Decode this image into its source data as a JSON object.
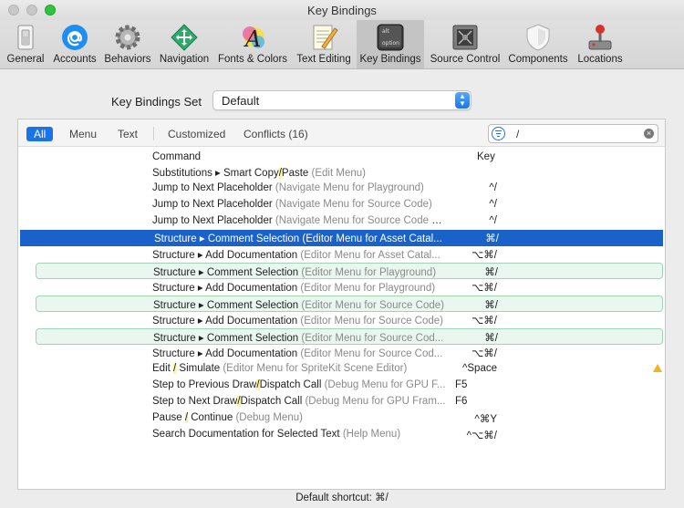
{
  "window": {
    "title": "Key Bindings"
  },
  "toolbar": {
    "items": [
      {
        "label": "General",
        "icon": "switch-icon"
      },
      {
        "label": "Accounts",
        "icon": "at-sign-icon"
      },
      {
        "label": "Behaviors",
        "icon": "gear-icon"
      },
      {
        "label": "Navigation",
        "icon": "move-arrows-icon"
      },
      {
        "label": "Fonts & Colors",
        "icon": "font-a-icon"
      },
      {
        "label": "Text Editing",
        "icon": "notepad-pencil-icon"
      },
      {
        "label": "Key Bindings",
        "icon": "option-key-icon"
      },
      {
        "label": "Source Control",
        "icon": "vault-icon"
      },
      {
        "label": "Components",
        "icon": "shield-icon"
      },
      {
        "label": "Locations",
        "icon": "joystick-icon"
      }
    ]
  },
  "key_bindings_set": {
    "label": "Key Bindings Set",
    "value": "Default"
  },
  "filters": {
    "all": "All",
    "menu": "Menu",
    "text": "Text",
    "customized": "Customized",
    "conflicts": "Conflicts (16)"
  },
  "search": {
    "value": "/"
  },
  "columns": {
    "command": "Command",
    "key": "Key"
  },
  "rows": [
    {
      "pre": "Substitutions ▸ Smart Copy",
      "hl": "/",
      "post": "Paste",
      "ctx": " (Edit Menu)",
      "key": "",
      "state": "normal"
    },
    {
      "pre": "Jump to Next Placeholder",
      "hl": "",
      "post": "",
      "ctx": " (Navigate Menu for Playground)",
      "key": "^/",
      "state": "normal"
    },
    {
      "pre": "Jump to Next Placeholder",
      "hl": "",
      "post": "",
      "ctx": " (Navigate Menu for Source Code)",
      "key": "^/",
      "state": "normal"
    },
    {
      "pre": "Jump to Next Placeholder",
      "hl": "",
      "post": "",
      "ctx": " (Navigate Menu for Source Code C...",
      "key": "^/",
      "state": "normal"
    },
    {
      "pre": "Structure ▸ Comment Selection (Editor Menu for Asset Catal...",
      "hl": "",
      "post": "",
      "ctx": "",
      "key": "⌘/",
      "state": "selected"
    },
    {
      "pre": "Structure ▸ Add Documentation",
      "hl": "",
      "post": "",
      "ctx": " (Editor Menu for Asset Catal...",
      "key": "⌥⌘/",
      "state": "normal"
    },
    {
      "pre": "Structure ▸ Comment Selection",
      "hl": "",
      "post": "",
      "ctx": " (Editor Menu for Playground)",
      "key": "⌘/",
      "state": "conflict"
    },
    {
      "pre": "Structure ▸ Add Documentation",
      "hl": "",
      "post": "",
      "ctx": " (Editor Menu for Playground)",
      "key": "⌥⌘/",
      "state": "normal"
    },
    {
      "pre": "Structure ▸ Comment Selection",
      "hl": "",
      "post": "",
      "ctx": " (Editor Menu for Source Code)",
      "key": "⌘/",
      "state": "conflict"
    },
    {
      "pre": "Structure ▸ Add Documentation",
      "hl": "",
      "post": "",
      "ctx": " (Editor Menu for Source Code)",
      "key": "⌥⌘/",
      "state": "normal"
    },
    {
      "pre": "Structure ▸ Comment Selection",
      "hl": "",
      "post": "",
      "ctx": " (Editor Menu for Source Cod...",
      "key": "⌘/",
      "state": "conflict"
    },
    {
      "pre": "Structure ▸ Add Documentation",
      "hl": "",
      "post": "",
      "ctx": " (Editor Menu for Source Cod...",
      "key": "⌥⌘/",
      "state": "normal"
    },
    {
      "pre": "Edit ",
      "hl": "/",
      "post": " Simulate",
      "ctx": " (Editor Menu for SpriteKit Scene Editor)",
      "key": "^Space",
      "state": "normal",
      "warning": true
    },
    {
      "pre": "Step to Previous Draw",
      "hl": "/",
      "post": "Dispatch Call",
      "ctx": " (Debug Menu for GPU F...",
      "key": "F5",
      "state": "normal",
      "key_align": "left"
    },
    {
      "pre": "Step to Next Draw",
      "hl": "/",
      "post": "Dispatch Call",
      "ctx": " (Debug Menu for GPU Fram...",
      "key": "F6",
      "state": "normal",
      "key_align": "left"
    },
    {
      "pre": "Pause ",
      "hl": "/",
      "post": " Continue",
      "ctx": " (Debug Menu)",
      "key": "^⌘Y",
      "state": "normal"
    },
    {
      "pre": "Search Documentation for Selected Text",
      "hl": "",
      "post": "",
      "ctx": " (Help Menu)",
      "key": "^⌥⌘/",
      "state": "normal"
    }
  ],
  "status": {
    "default_shortcut": "Default shortcut: ⌘/"
  },
  "colors": {
    "accent": "#1a73e8",
    "selection": "#1a62c9",
    "conflict_bg": "#eaf7f0",
    "highlight": "#fff3a0"
  }
}
